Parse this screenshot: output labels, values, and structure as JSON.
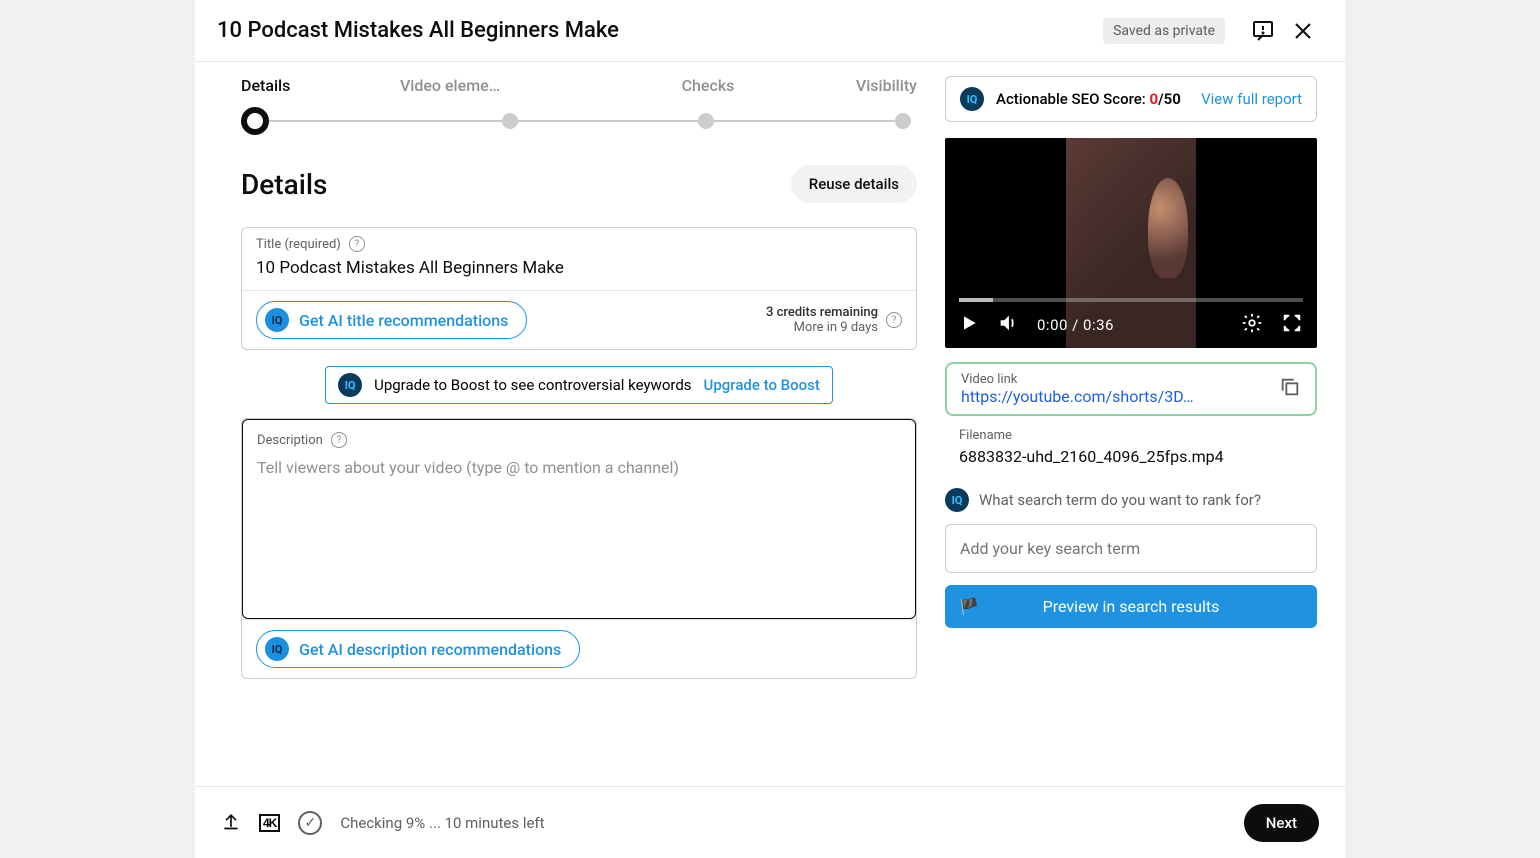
{
  "header": {
    "title": "10 Podcast Mistakes All Beginners Make",
    "saved_status": "Saved as private"
  },
  "stepper": {
    "steps": [
      "Details",
      "Video eleme…",
      "Checks",
      "Visibility"
    ],
    "active_index": 0
  },
  "seo": {
    "prefix": "Actionable SEO Score: ",
    "score_current": "0",
    "score_sep_max": "/50",
    "view_report": "View full report"
  },
  "details": {
    "heading": "Details",
    "reuse_btn": "Reuse details",
    "title_label": "Title (required)",
    "title_value": "10 Podcast Mistakes All Beginners Make",
    "ai_title_btn": "Get AI title recommendations",
    "credits_line1": "3 credits remaining",
    "credits_line2": "More in 9 days",
    "boost_text": "Upgrade to Boost to see controversial keywords",
    "boost_link": "Upgrade to Boost",
    "desc_label": "Description",
    "desc_placeholder": "Tell viewers about your video (type @ to mention a channel)",
    "ai_desc_btn": "Get AI description recommendations"
  },
  "player": {
    "time": "0:00 / 0:36"
  },
  "video_info": {
    "link_label": "Video link",
    "link_value": "https://youtube.com/shorts/3D…",
    "filename_label": "Filename",
    "filename_value": "6883832-uhd_2160_4096_25fps.mp4"
  },
  "search": {
    "prompt": "What search term do you want to rank for?",
    "placeholder": "Add your key search term",
    "preview_btn": "Preview in search results"
  },
  "footer": {
    "status": "Checking 9% ... 10 minutes left",
    "next": "Next"
  }
}
